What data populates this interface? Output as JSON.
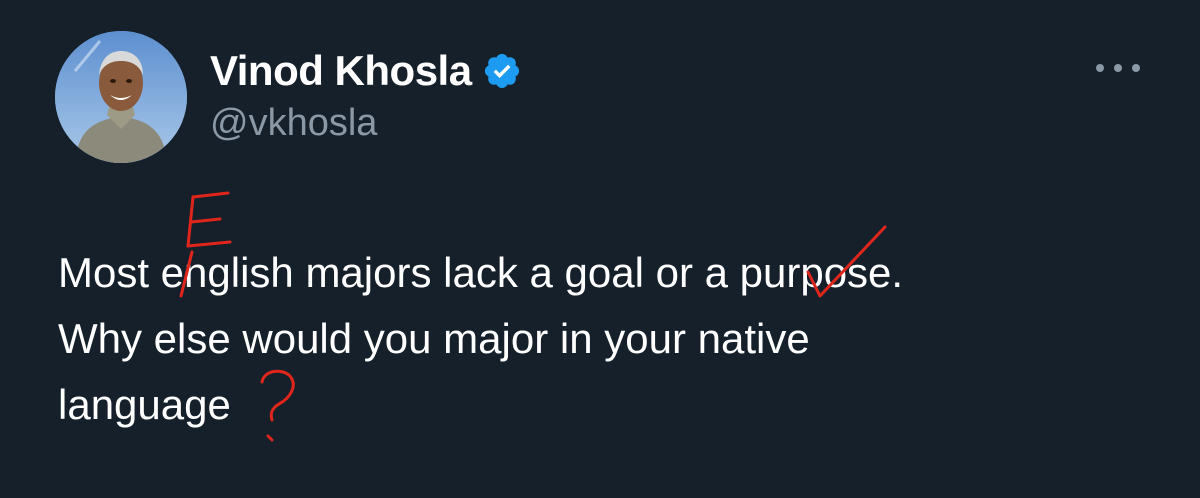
{
  "author": {
    "display_name": "Vinod Khosla",
    "handle": "@vkhosla",
    "verified": true,
    "avatar_icon": "profile-photo",
    "verified_icon": "verified-badge-icon",
    "more_icon": "more-options-icon"
  },
  "tweet": {
    "lines": [
      "Most english majors lack a goal or a purpose.",
      "Why else would you major in your native",
      "language"
    ]
  },
  "annotations": {
    "e_correction": "E",
    "question_mark": "?",
    "color": "#e0251b"
  },
  "colors": {
    "background": "#15202b",
    "text": "#ffffff",
    "secondary_text": "#8b98a5",
    "verified": "#1d9bf0"
  }
}
